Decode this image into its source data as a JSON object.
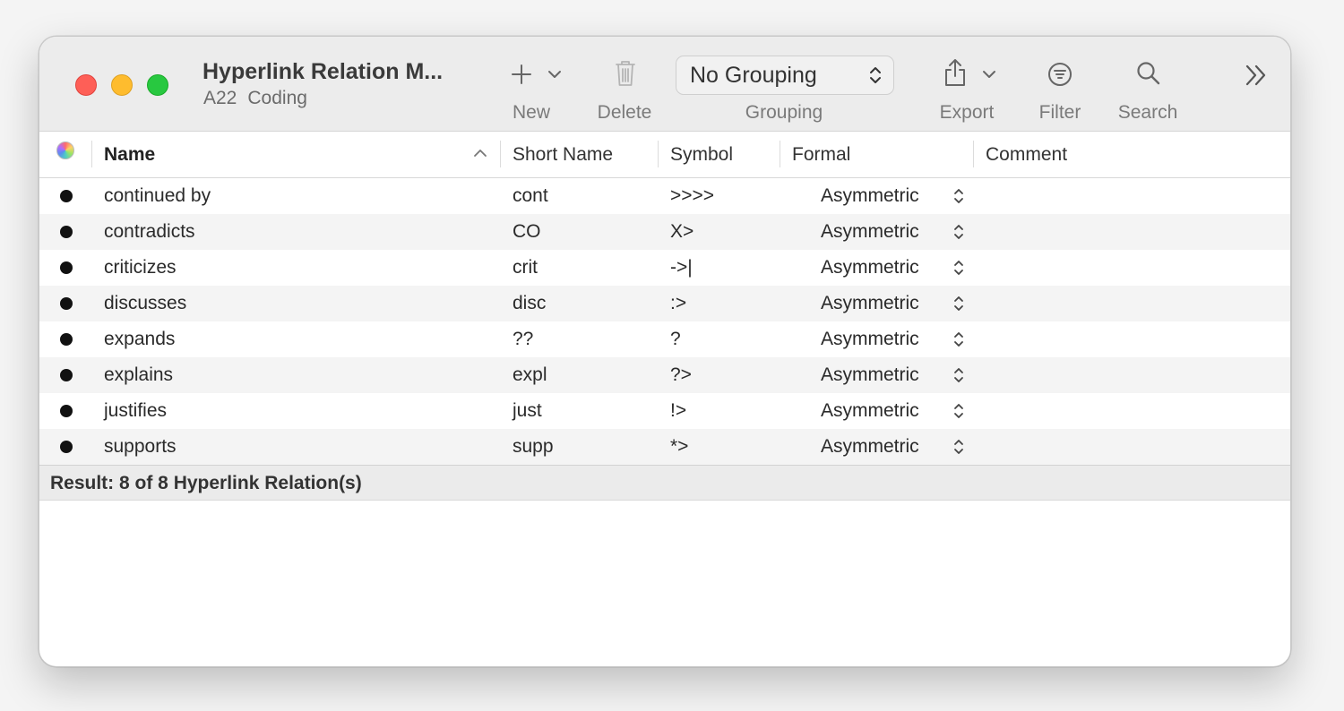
{
  "window": {
    "title": "Hyperlink Relation M...",
    "subtitle_project": "A22",
    "subtitle_section": "Coding"
  },
  "toolbar": {
    "new_label": "New",
    "delete_label": "Delete",
    "grouping_value": "No Grouping",
    "grouping_label": "Grouping",
    "export_label": "Export",
    "filter_label": "Filter",
    "search_label": "Search"
  },
  "icons": {
    "new": "plus-icon",
    "new_menu": "chevron-down-icon",
    "delete": "trash-icon",
    "grouping": "updown-chevrons-icon",
    "export": "share-icon",
    "export_menu": "chevron-down-icon",
    "filter": "filter-icon",
    "search": "magnifier-icon",
    "overflow": "double-chevron-right-icon",
    "color_column": "color-wheel-icon",
    "sort": "chevron-up-icon"
  },
  "colors": {
    "close": "#fe5f57",
    "minimize": "#febc2e",
    "zoom": "#28c840",
    "row_alt": "#f4f4f4",
    "relation_color": "#111111"
  },
  "table": {
    "columns": {
      "name": "Name",
      "short_name": "Short Name",
      "symbol": "Symbol",
      "formal": "Formal",
      "comment": "Comment"
    },
    "sort_column": "Name",
    "sort_direction": "ascending",
    "rows": [
      {
        "name": "continued by",
        "short_name": "cont",
        "symbol": ">>>>",
        "formal": "Asymmetric",
        "comment": ""
      },
      {
        "name": "contradicts",
        "short_name": "CO",
        "symbol": "X>",
        "formal": "Asymmetric",
        "comment": ""
      },
      {
        "name": "criticizes",
        "short_name": "crit",
        "symbol": "->|",
        "formal": "Asymmetric",
        "comment": ""
      },
      {
        "name": "discusses",
        "short_name": "disc",
        "symbol": ":>",
        "formal": "Asymmetric",
        "comment": ""
      },
      {
        "name": "expands",
        "short_name": "??",
        "symbol": "?",
        "formal": "Asymmetric",
        "comment": ""
      },
      {
        "name": "explains",
        "short_name": "expl",
        "symbol": "?>",
        "formal": "Asymmetric",
        "comment": ""
      },
      {
        "name": "justifies",
        "short_name": "just",
        "symbol": "!>",
        "formal": "Asymmetric",
        "comment": ""
      },
      {
        "name": "supports",
        "short_name": "supp",
        "symbol": "*>",
        "formal": "Asymmetric",
        "comment": ""
      }
    ]
  },
  "status": {
    "result_text": "Result: 8 of 8 Hyperlink Relation(s)"
  }
}
